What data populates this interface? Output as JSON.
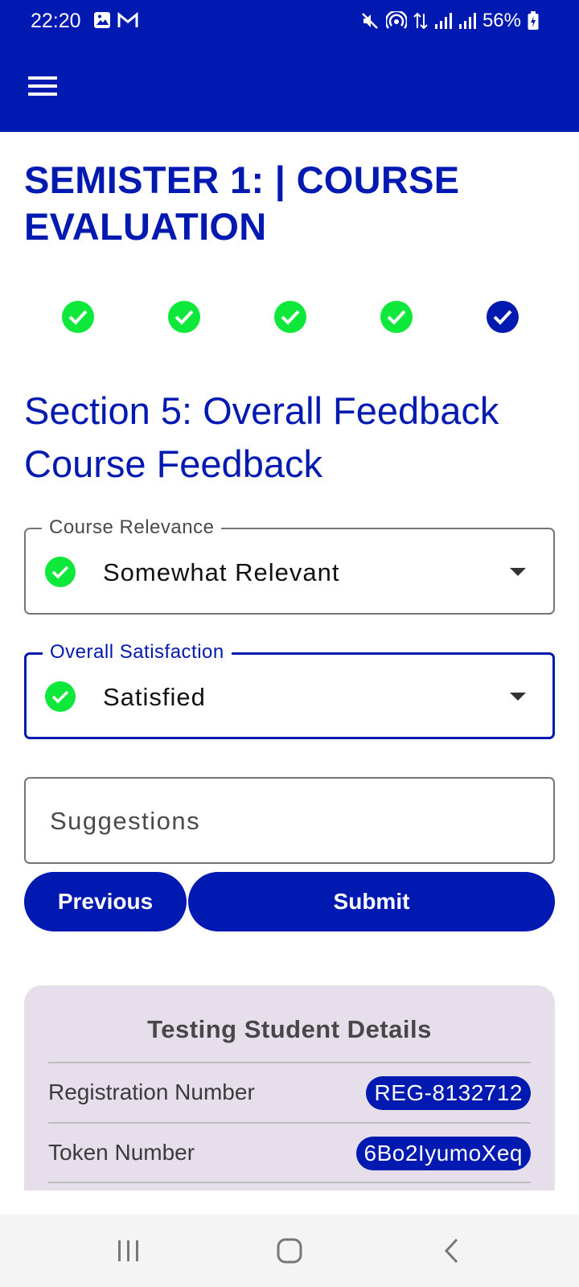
{
  "status_bar": {
    "time": "22:20",
    "battery": "56%",
    "icons": [
      "gallery-icon",
      "gmail-icon",
      "mute-icon",
      "hotspot-icon",
      "data-arrows-icon",
      "signal-icon",
      "signal-icon",
      "battery-charging-icon"
    ]
  },
  "app_bar": {
    "menu_icon": "hamburger-menu-icon",
    "color": "#0019b0"
  },
  "page": {
    "title": "SEMISTER 1: | COURSE EVALUATION"
  },
  "stepper": {
    "steps": [
      {
        "status": "done",
        "icon": "check-icon",
        "color": "#0ee83a"
      },
      {
        "status": "done",
        "icon": "check-icon",
        "color": "#0ee83a"
      },
      {
        "status": "done",
        "icon": "check-icon",
        "color": "#0ee83a"
      },
      {
        "status": "done",
        "icon": "check-icon",
        "color": "#0ee83a"
      },
      {
        "status": "current",
        "icon": "check-icon",
        "color": "#0019b0"
      }
    ]
  },
  "section": {
    "title_line1": "Section 5: Overall Feedback",
    "title_line2": "Course Feedback"
  },
  "form": {
    "course_relevance": {
      "label": "Course Relevance",
      "value": "Somewhat Relevant"
    },
    "overall_satisfaction": {
      "label": "Overall Satisfaction",
      "value": "Satisfied"
    },
    "suggestions": {
      "placeholder": "Suggestions",
      "value": ""
    }
  },
  "buttons": {
    "previous": "Previous",
    "submit": "Submit"
  },
  "details_card": {
    "title": "Testing Student Details",
    "rows": [
      {
        "label": "Registration Number",
        "value": "REG-8132712"
      },
      {
        "label": "Token Number",
        "value": "6Bo2IyumoXeq"
      }
    ]
  },
  "nav_bar": {
    "buttons": [
      "recent-apps-icon",
      "home-icon",
      "back-icon"
    ]
  }
}
